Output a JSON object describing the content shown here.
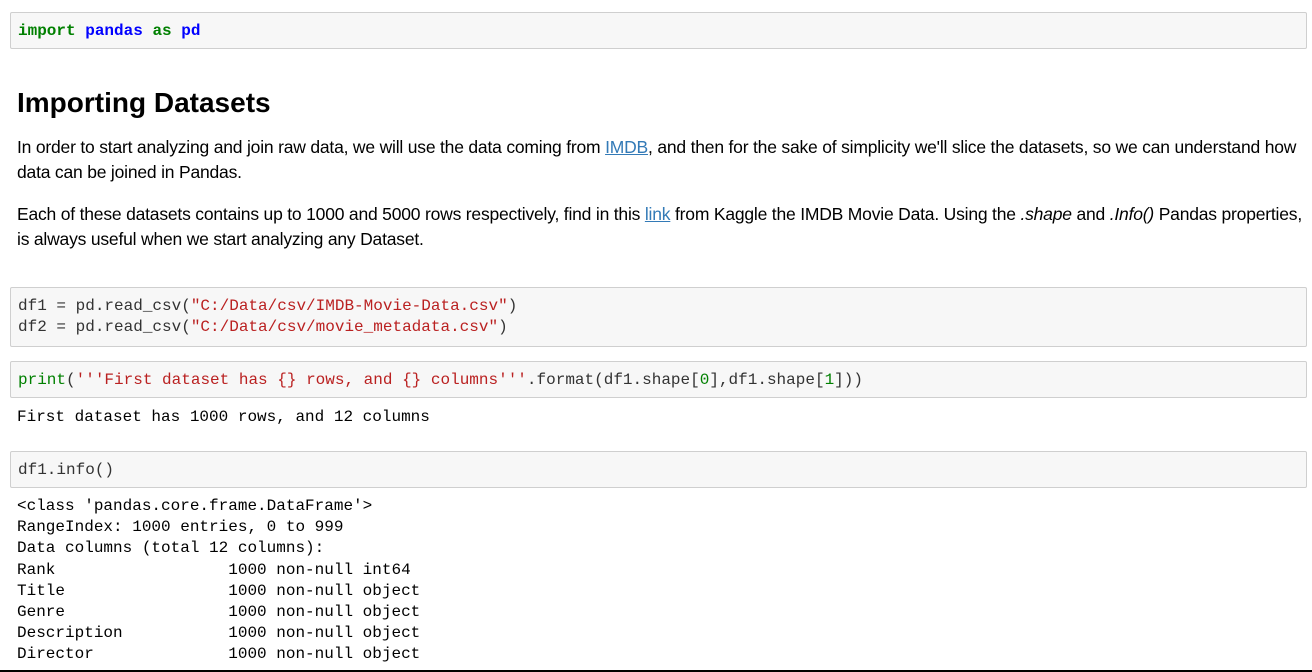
{
  "cells": {
    "import": {
      "kw_import": "import",
      "mod": "pandas",
      "kw_as": "as",
      "alias": "pd"
    },
    "heading": "Importing Datasets",
    "para1": {
      "before": "In order to start analyzing and join raw data, we will use the data coming from ",
      "link": "IMDB",
      "after": ", and then for the sake of simplicity we'll slice the datasets, so we can understand how data can be joined in Pandas."
    },
    "para2": {
      "before": "Each of these datasets contains up to 1000 and 5000 rows respectively, find in this ",
      "link": "link",
      "middle": " from Kaggle the IMDB Movie Data. Using the ",
      "em1": ".shape",
      "and": " and ",
      "em2": ".Info()",
      "after": " Pandas properties, is always useful when we start analyzing any Dataset."
    },
    "read": {
      "l1_pre": "df1 = pd.read_csv(",
      "l1_str": "\"C:/Data/csv/IMDB-Movie-Data.csv\"",
      "l1_post": ")",
      "l2_pre": "df2 = pd.read_csv(",
      "l2_str": "\"C:/Data/csv/movie_metadata.csv\"",
      "l2_post": ")"
    },
    "print": {
      "fn": "print",
      "paren": "(",
      "str": "'''First dataset has {} rows, and {} columns'''",
      "mid": ".format(df1.shape[",
      "n0": "0",
      "mid2": "],df1.shape[",
      "n1": "1",
      "end": "]))"
    },
    "print_output": "First dataset has 1000 rows, and 12 columns",
    "info": {
      "code": "df1.info()"
    },
    "info_output": [
      "<class 'pandas.core.frame.DataFrame'>",
      "RangeIndex: 1000 entries, 0 to 999",
      "Data columns (total 12 columns):",
      "Rank                  1000 non-null int64",
      "Title                 1000 non-null object",
      "Genre                 1000 non-null object",
      "Description           1000 non-null object",
      "Director              1000 non-null object"
    ]
  }
}
